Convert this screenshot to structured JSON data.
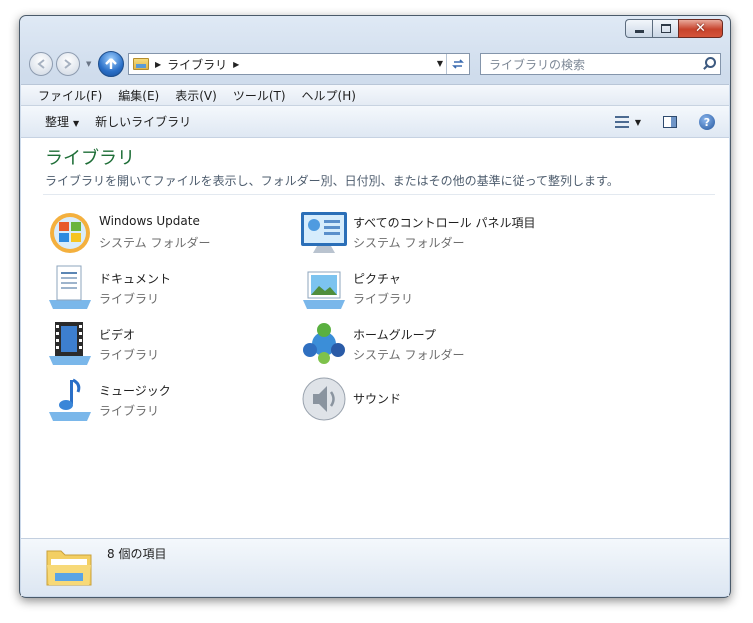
{
  "window": {
    "caption": {
      "minimize": "–",
      "maximize": "□",
      "close": "✕"
    }
  },
  "nav": {
    "breadcrumb": [
      "ライブラリ"
    ],
    "search_placeholder": "ライブラリの検索"
  },
  "menu": {
    "items": [
      "ファイル(F)",
      "編集(E)",
      "表示(V)",
      "ツール(T)",
      "ヘルプ(H)"
    ]
  },
  "commands": {
    "organize": "整理",
    "new_library": "新しいライブラリ",
    "help_glyph": "?"
  },
  "content": {
    "title": "ライブラリ",
    "description": "ライブラリを開いてファイルを表示し、フォルダー別、日付別、またはその他の基準に従って整列します。",
    "items": [
      {
        "name": "Windows Update",
        "type": "システム フォルダー",
        "icon": "windows-update-icon"
      },
      {
        "name": "すべてのコントロール パネル項目",
        "type": "システム フォルダー",
        "icon": "control-panel-icon"
      },
      {
        "name": "ドキュメント",
        "type": "ライブラリ",
        "icon": "documents-icon"
      },
      {
        "name": "ピクチャ",
        "type": "ライブラリ",
        "icon": "pictures-icon"
      },
      {
        "name": "ビデオ",
        "type": "ライブラリ",
        "icon": "videos-icon"
      },
      {
        "name": "ホームグループ",
        "type": "システム フォルダー",
        "icon": "homegroup-icon"
      },
      {
        "name": "ミュージック",
        "type": "ライブラリ",
        "icon": "music-icon"
      },
      {
        "name": "サウンド",
        "type": "",
        "icon": "sound-icon"
      }
    ]
  },
  "status": {
    "count_text": "8 個の項目",
    "icon": "library-folder-icon"
  },
  "colors": {
    "title_green": "#1e6e37",
    "close_red": "#c7432c",
    "frame_blue": "#cad8ea"
  }
}
